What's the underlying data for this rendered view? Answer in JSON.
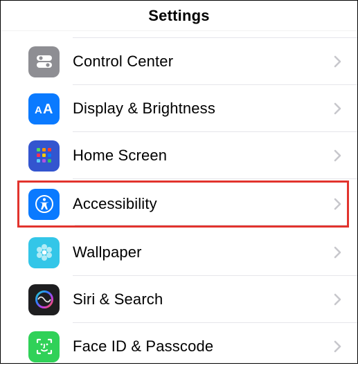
{
  "header": {
    "title": "Settings"
  },
  "rows": [
    {
      "id": "control-center",
      "label": "Control Center",
      "icon": "toggles",
      "bg": "#8e8e93"
    },
    {
      "id": "display-brightness",
      "label": "Display & Brightness",
      "icon": "text-size",
      "bg": "#0a7aff"
    },
    {
      "id": "home-screen",
      "label": "Home Screen",
      "icon": "app-grid",
      "bg": "#3355cf"
    },
    {
      "id": "accessibility",
      "label": "Accessibility",
      "icon": "accessibility",
      "bg": "#0a7aff",
      "highlight": true
    },
    {
      "id": "wallpaper",
      "label": "Wallpaper",
      "icon": "flower",
      "bg": "#33c6e8"
    },
    {
      "id": "siri-search",
      "label": "Siri & Search",
      "icon": "siri",
      "bg": "#1e1e20"
    },
    {
      "id": "face-id-passcode",
      "label": "Face ID & Passcode",
      "icon": "face-id",
      "bg": "#30d158"
    }
  ]
}
